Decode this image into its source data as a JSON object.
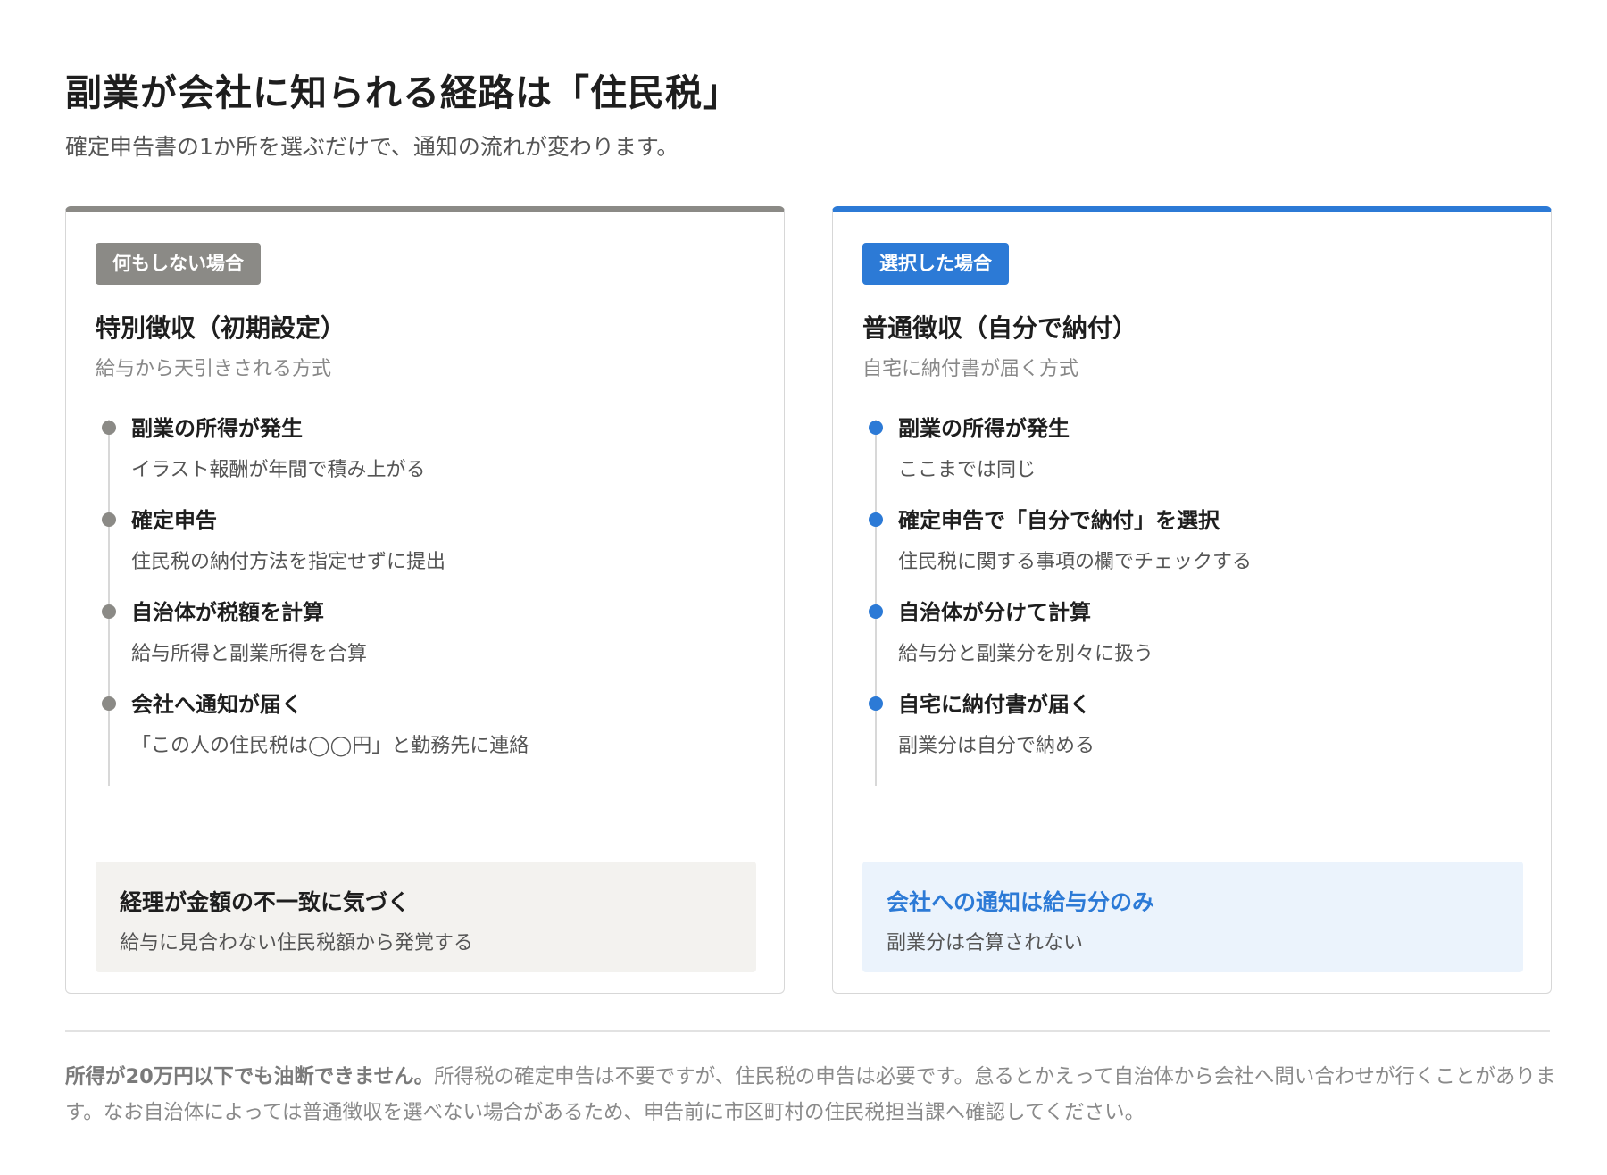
{
  "header": {
    "title": "副業が会社に知られる経路は「住民税」",
    "subtitle": "確定申告書の1か所を選ぶだけで、通知の流れが変わります。"
  },
  "colors": {
    "neutral": "#8b8a86",
    "accent": "#2c7ad6"
  },
  "cards": [
    {
      "badge": "何もしない場合",
      "title": "特別徴収（初期設定）",
      "subtitle": "給与から天引きされる方式",
      "steps": [
        {
          "title": "副業の所得が発生",
          "desc": "イラスト報酬が年間で積み上がる"
        },
        {
          "title": "確定申告",
          "desc": "住民税の納付方法を指定せずに提出"
        },
        {
          "title": "自治体が税額を計算",
          "desc": "給与所得と副業所得を合算"
        },
        {
          "title": "会社へ通知が届く",
          "desc": "「この人の住民税は◯◯円」と勤務先に連絡"
        }
      ],
      "result": {
        "title": "経理が金額の不一致に気づく",
        "desc": "給与に見合わない住民税額から発覚する"
      }
    },
    {
      "badge": "選択した場合",
      "title": "普通徴収（自分で納付）",
      "subtitle": "自宅に納付書が届く方式",
      "steps": [
        {
          "title": "副業の所得が発生",
          "desc": "ここまでは同じ"
        },
        {
          "title": "確定申告で「自分で納付」を選択",
          "desc": "住民税に関する事項の欄でチェックする"
        },
        {
          "title": "自治体が分けて計算",
          "desc": "給与分と副業分を別々に扱う"
        },
        {
          "title": "自宅に納付書が届く",
          "desc": "副業分は自分で納める"
        }
      ],
      "result": {
        "title": "会社への通知は給与分のみ",
        "desc": "副業分は合算されない"
      }
    }
  ],
  "footnote": {
    "lead": "所得が20万円以下でも油断できません。",
    "body": "所得税の確定申告は不要ですが、住民税の申告は必要です。怠るとかえって自治体から会社へ問い合わせが行くことがあります。なお自治体によっては普通徴収を選べない場合があるため、申告前に市区町村の住民税担当課へ確認してください。"
  }
}
